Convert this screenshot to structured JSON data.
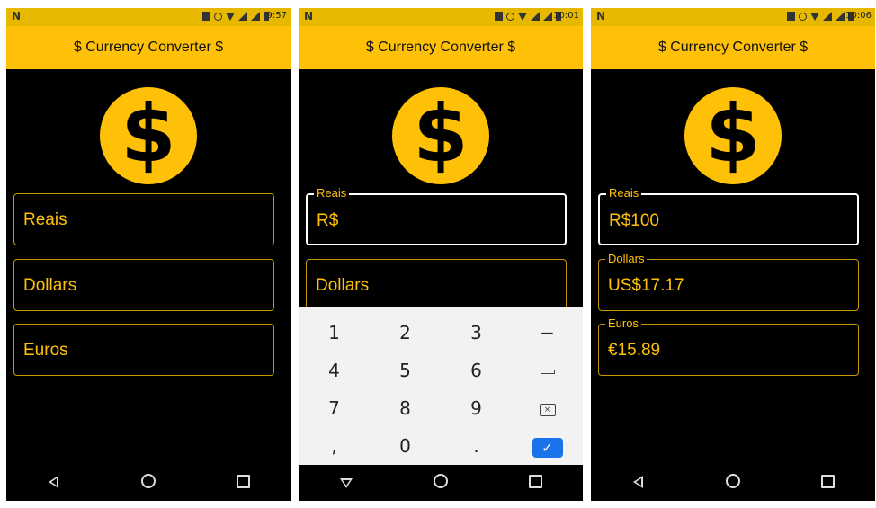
{
  "app": {
    "title": "$ Currency Converter $",
    "logo_symbol": "$",
    "colors": {
      "accent": "#ffc107",
      "background": "#000000",
      "keyboard_ok": "#1a73e8"
    }
  },
  "screens": [
    {
      "status": {
        "carrier_icon": "N",
        "time": "9:57"
      },
      "fields": [
        {
          "label": "Reais",
          "value": ""
        },
        {
          "label": "Dollars",
          "value": ""
        },
        {
          "label": "Euros",
          "value": ""
        }
      ]
    },
    {
      "status": {
        "carrier_icon": "N",
        "time": "10:01"
      },
      "fields": [
        {
          "label": "Reais",
          "value": "R$"
        },
        {
          "label": "Dollars",
          "value": ""
        }
      ],
      "keyboard": {
        "rows": [
          [
            "1",
            "2",
            "3",
            "−"
          ],
          [
            "4",
            "5",
            "6",
            "space-icon"
          ],
          [
            "7",
            "8",
            "9",
            "backspace-icon"
          ],
          [
            ",",
            "0",
            ".",
            "check-icon"
          ]
        ]
      }
    },
    {
      "status": {
        "carrier_icon": "N",
        "time": "10:06"
      },
      "fields": [
        {
          "label": "Reais",
          "value": "R$100"
        },
        {
          "label": "Dollars",
          "value": "US$17.17"
        },
        {
          "label": "Euros",
          "value": "€15.89"
        }
      ]
    }
  ],
  "keyboard_glyphs": {
    "minus": "−",
    "ok": "✓",
    "backspace": "×"
  }
}
